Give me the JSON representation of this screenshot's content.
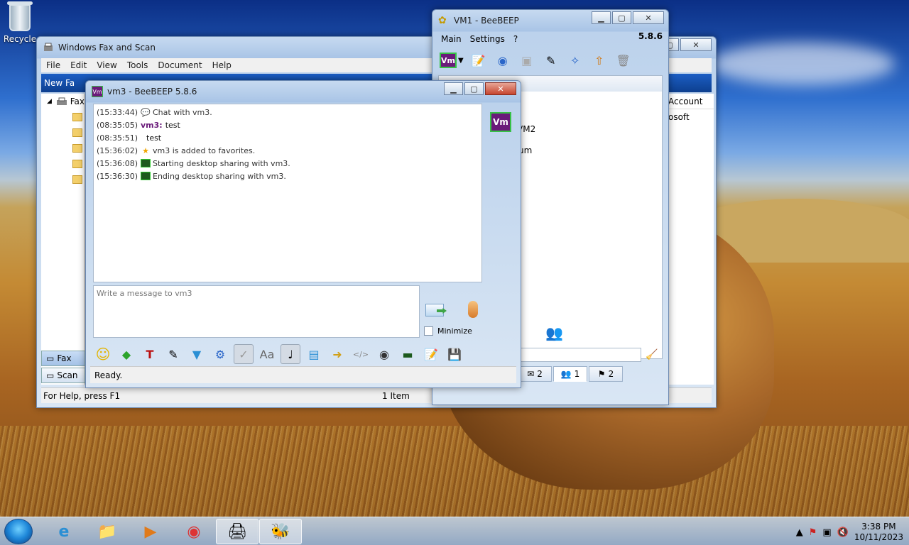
{
  "desktop": {
    "recycle_label": "Recycle"
  },
  "fax_window": {
    "title": "Windows Fax and Scan",
    "menu": [
      "File",
      "Edit",
      "View",
      "Tools",
      "Document",
      "Help"
    ],
    "ribbon_label": "New Fa",
    "tree_root": "Fax",
    "right_col_header": "Account",
    "right_col_value": "osoft",
    "nav_fax": "Fax",
    "nav_scan": "Scan",
    "status_help": "For Help, press F1",
    "status_items": "1 Item"
  },
  "vm1_window": {
    "title": "VM1 - BeeBEEP",
    "menu": [
      "Main",
      "Settings",
      "?"
    ],
    "version": "5.8.6",
    "list_text_1": "VM2",
    "list_text_2": "um",
    "tabs": [
      {
        "icon": "chat",
        "count": "2"
      },
      {
        "icon": "users",
        "count": "1"
      },
      {
        "icon": "groups",
        "count": "2"
      }
    ]
  },
  "chat_window": {
    "title": "vm3 - BeeBEEP 5.8.6",
    "avatar_label": "Vm",
    "messages": [
      {
        "ts": "(15:33:44)",
        "icon": "speech-bubble",
        "text": "Chat with vm3."
      },
      {
        "ts": "(08:35:05)",
        "sender": "vm3:",
        "text": "test"
      },
      {
        "ts": "(08:35:51)",
        "text": "test"
      },
      {
        "ts": "(15:36:02)",
        "icon": "star",
        "text": "vm3 is added to favorites."
      },
      {
        "ts": "(15:36:08)",
        "icon": "screen",
        "text": "Starting desktop sharing with vm3."
      },
      {
        "ts": "(15:36:30)",
        "icon": "screen",
        "text": "Ending desktop sharing with vm3."
      }
    ],
    "compose_placeholder": "Write a message to vm3",
    "minimize_label": "Minimize",
    "status": "Ready."
  },
  "taskbar": {
    "time": "3:38 PM",
    "date": "10/11/2023"
  },
  "colors": {
    "beebeep_purple": "#6a1a7a",
    "beebeep_green": "#37c146",
    "close_red": "#c6452f"
  }
}
